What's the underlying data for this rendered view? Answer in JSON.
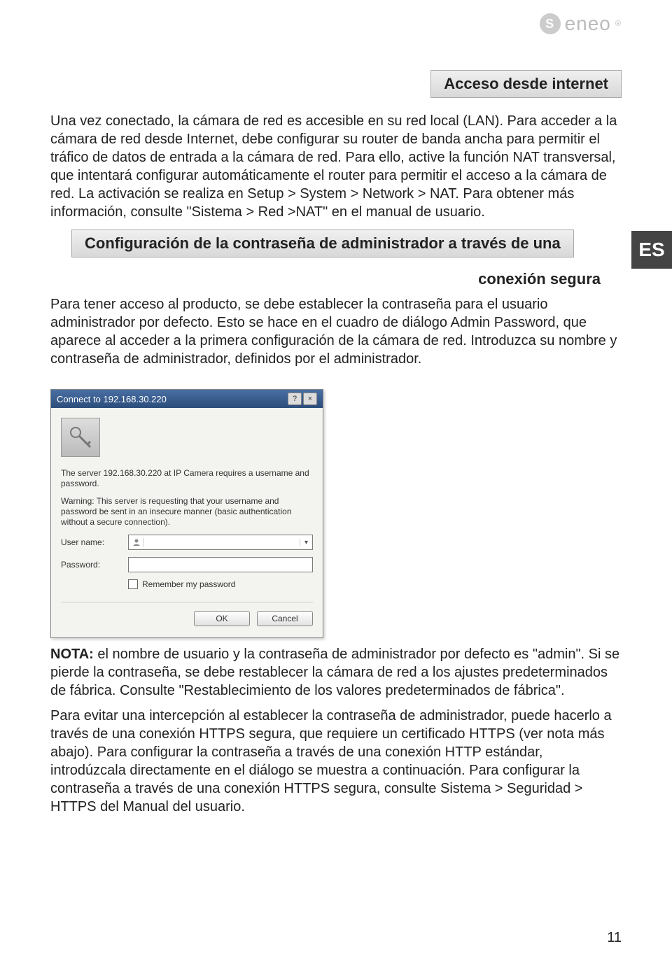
{
  "brand": {
    "name": "eneo",
    "tm": "®"
  },
  "lang_tab": "ES",
  "heading1": "Acceso desde internet",
  "para1": "Una vez conectado, la cámara de red es accesible en su red local (LAN). Para acceder a la cámara de red desde Internet, debe configurar su router de banda ancha para permitir el tráfico de datos de entrada a la cámara de red. Para ello, active la función NAT transversal, que intentará configurar automáticamente el router para permitir el acceso a la cámara de red. La activación se realiza en Setup > System > Network > NAT. Para obtener más información, consulte \"Sistema > Red >NAT\" en el manual de usuario.",
  "heading2": "Configuración de la contraseña de administrador a través de una",
  "heading2_right": "conexión segura",
  "para2": "Para tener acceso al producto, se debe establecer la contraseña para el usuario administrador por defecto. Esto se hace en el cuadro de diálogo Admin Password, que aparece al acceder a la primera configuración de la cámara de red. Introduzca su nombre y contraseña de administrador, definidos por el administrador.",
  "dialog": {
    "title": "Connect to 192.168.30.220",
    "help": "?",
    "close": "×",
    "msg1": "The server 192.168.30.220 at IP Camera requires a username and password.",
    "msg2": "Warning: This server is requesting that your username and password be sent in an insecure manner (basic authentication without a secure connection).",
    "user_label": "User name:",
    "user_value": "",
    "pass_label": "Password:",
    "pass_value": "",
    "remember": "Remember my password",
    "ok": "OK",
    "cancel": "Cancel"
  },
  "note_bold": "NOTA:",
  "note_text": " el nombre de usuario y la contraseña de administrador por defecto es \"admin\". Si se pierde la contraseña, se debe restablecer la cámara de red a los ajustes predeterminados de fábrica. Consulte \"Restablecimiento de los valores predeterminados de fábrica\".",
  "para3": "Para evitar una intercepción al establecer la contraseña de administrador, puede hacerlo a través de una conexión HTTPS segura, que requiere un certificado HTTPS (ver nota más abajo). Para configurar la contraseña a través de una conexión HTTP estándar, introdúzcala directamente en el diálogo se muestra a continuación. Para configurar la contraseña a través de una conexión HTTPS segura, consulte Sistema > Seguridad > HTTPS del Manual del usuario.",
  "page_number": "11"
}
